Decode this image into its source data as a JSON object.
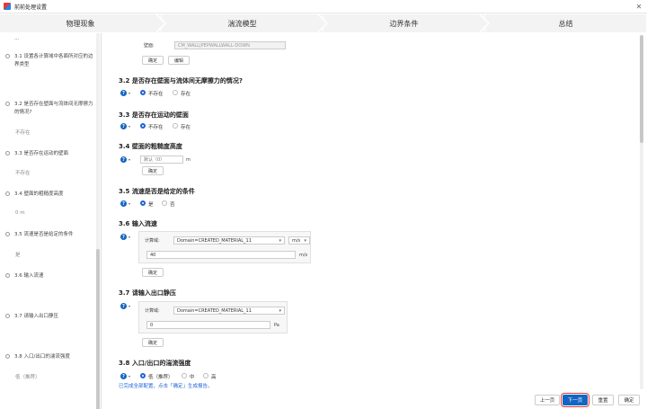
{
  "window": {
    "title": "前前处理设置",
    "close_glyph": "✕"
  },
  "steps": [
    "物理现象",
    "湍流模型",
    "边界条件",
    "总结"
  ],
  "sidebar": {
    "items": [
      {
        "label": "3.1 设置各计算域中各面所对应的边界类型",
        "answer": ""
      },
      {
        "label": "3.2 是否存在壁面与流体间无摩擦力的情况?",
        "answer": "不存在"
      },
      {
        "label": "3.3 是否存在运动的壁面",
        "answer": "不存在"
      },
      {
        "label": "3.4 壁面的粗糙度高度",
        "answer": "0 m"
      },
      {
        "label": "3.5 流速是否是给定的条件",
        "answer": "是"
      },
      {
        "label": "3.6 输入流速",
        "answer": ""
      },
      {
        "label": "3.7 请输入出口静压",
        "answer": ""
      },
      {
        "label": "3.8 入口/出口的湍流强度",
        "answer": "低（推荐）"
      }
    ]
  },
  "main": {
    "wall": {
      "label": "壁面:",
      "value": "CM_WALL|PEPWALLWALL-DOWN",
      "confirm": "确定",
      "edit": "编辑"
    },
    "s32": {
      "title": "3.2 是否存在壁面与流体间无摩擦力的情况?",
      "opt1": "不存在",
      "opt2": "存在"
    },
    "s33": {
      "title": "3.3 是否存在运动的壁面",
      "opt1": "不存在",
      "opt2": "存在"
    },
    "s34": {
      "title": "3.4 壁面的粗糙度高度",
      "placeholder": "默认（0）",
      "unit": "m",
      "confirm": "确定"
    },
    "s35": {
      "title": "3.5 流速是否是给定的条件",
      "opt1": "是",
      "opt2": "否"
    },
    "s36": {
      "title": "3.6 输入流速",
      "domain_label": "计算域:",
      "domain_value": "Domain=CREATED_MATERIAL_11",
      "unit_select": "m/s",
      "value": "40",
      "unit": "m/s",
      "confirm": "确定"
    },
    "s37": {
      "title": "3.7 请输入出口静压",
      "domain_label": "计算域:",
      "domain_value": "Domain=CREATED_MATERIAL_11",
      "value": "0",
      "unit": "Pa",
      "confirm": "确定"
    },
    "s38": {
      "title": "3.8 入口/出口的湍流强度",
      "opt1": "低（推荐）",
      "opt2": "中",
      "opt3": "高"
    },
    "notice": "已完成全部配置，点击「确定」生成报告。"
  },
  "footer": {
    "prev": "上一页",
    "next": "下一页",
    "reset": "重置",
    "ok": "确定"
  },
  "colors": {
    "accent": "#1565c0",
    "highlight": "#e53935"
  }
}
